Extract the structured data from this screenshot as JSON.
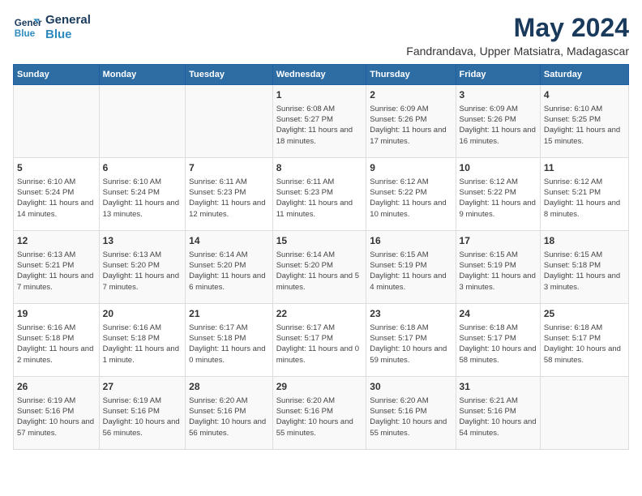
{
  "header": {
    "logo_line1": "General",
    "logo_line2": "Blue",
    "month_title": "May 2024",
    "location": "Fandrandava, Upper Matsiatra, Madagascar"
  },
  "days_of_week": [
    "Sunday",
    "Monday",
    "Tuesday",
    "Wednesday",
    "Thursday",
    "Friday",
    "Saturday"
  ],
  "weeks": [
    [
      {
        "day": "",
        "info": ""
      },
      {
        "day": "",
        "info": ""
      },
      {
        "day": "",
        "info": ""
      },
      {
        "day": "1",
        "info": "Sunrise: 6:08 AM\nSunset: 5:27 PM\nDaylight: 11 hours and 18 minutes."
      },
      {
        "day": "2",
        "info": "Sunrise: 6:09 AM\nSunset: 5:26 PM\nDaylight: 11 hours and 17 minutes."
      },
      {
        "day": "3",
        "info": "Sunrise: 6:09 AM\nSunset: 5:26 PM\nDaylight: 11 hours and 16 minutes."
      },
      {
        "day": "4",
        "info": "Sunrise: 6:10 AM\nSunset: 5:25 PM\nDaylight: 11 hours and 15 minutes."
      }
    ],
    [
      {
        "day": "5",
        "info": "Sunrise: 6:10 AM\nSunset: 5:24 PM\nDaylight: 11 hours and 14 minutes."
      },
      {
        "day": "6",
        "info": "Sunrise: 6:10 AM\nSunset: 5:24 PM\nDaylight: 11 hours and 13 minutes."
      },
      {
        "day": "7",
        "info": "Sunrise: 6:11 AM\nSunset: 5:23 PM\nDaylight: 11 hours and 12 minutes."
      },
      {
        "day": "8",
        "info": "Sunrise: 6:11 AM\nSunset: 5:23 PM\nDaylight: 11 hours and 11 minutes."
      },
      {
        "day": "9",
        "info": "Sunrise: 6:12 AM\nSunset: 5:22 PM\nDaylight: 11 hours and 10 minutes."
      },
      {
        "day": "10",
        "info": "Sunrise: 6:12 AM\nSunset: 5:22 PM\nDaylight: 11 hours and 9 minutes."
      },
      {
        "day": "11",
        "info": "Sunrise: 6:12 AM\nSunset: 5:21 PM\nDaylight: 11 hours and 8 minutes."
      }
    ],
    [
      {
        "day": "12",
        "info": "Sunrise: 6:13 AM\nSunset: 5:21 PM\nDaylight: 11 hours and 7 minutes."
      },
      {
        "day": "13",
        "info": "Sunrise: 6:13 AM\nSunset: 5:20 PM\nDaylight: 11 hours and 7 minutes."
      },
      {
        "day": "14",
        "info": "Sunrise: 6:14 AM\nSunset: 5:20 PM\nDaylight: 11 hours and 6 minutes."
      },
      {
        "day": "15",
        "info": "Sunrise: 6:14 AM\nSunset: 5:20 PM\nDaylight: 11 hours and 5 minutes."
      },
      {
        "day": "16",
        "info": "Sunrise: 6:15 AM\nSunset: 5:19 PM\nDaylight: 11 hours and 4 minutes."
      },
      {
        "day": "17",
        "info": "Sunrise: 6:15 AM\nSunset: 5:19 PM\nDaylight: 11 hours and 3 minutes."
      },
      {
        "day": "18",
        "info": "Sunrise: 6:15 AM\nSunset: 5:18 PM\nDaylight: 11 hours and 3 minutes."
      }
    ],
    [
      {
        "day": "19",
        "info": "Sunrise: 6:16 AM\nSunset: 5:18 PM\nDaylight: 11 hours and 2 minutes."
      },
      {
        "day": "20",
        "info": "Sunrise: 6:16 AM\nSunset: 5:18 PM\nDaylight: 11 hours and 1 minute."
      },
      {
        "day": "21",
        "info": "Sunrise: 6:17 AM\nSunset: 5:18 PM\nDaylight: 11 hours and 0 minutes."
      },
      {
        "day": "22",
        "info": "Sunrise: 6:17 AM\nSunset: 5:17 PM\nDaylight: 11 hours and 0 minutes."
      },
      {
        "day": "23",
        "info": "Sunrise: 6:18 AM\nSunset: 5:17 PM\nDaylight: 10 hours and 59 minutes."
      },
      {
        "day": "24",
        "info": "Sunrise: 6:18 AM\nSunset: 5:17 PM\nDaylight: 10 hours and 58 minutes."
      },
      {
        "day": "25",
        "info": "Sunrise: 6:18 AM\nSunset: 5:17 PM\nDaylight: 10 hours and 58 minutes."
      }
    ],
    [
      {
        "day": "26",
        "info": "Sunrise: 6:19 AM\nSunset: 5:16 PM\nDaylight: 10 hours and 57 minutes."
      },
      {
        "day": "27",
        "info": "Sunrise: 6:19 AM\nSunset: 5:16 PM\nDaylight: 10 hours and 56 minutes."
      },
      {
        "day": "28",
        "info": "Sunrise: 6:20 AM\nSunset: 5:16 PM\nDaylight: 10 hours and 56 minutes."
      },
      {
        "day": "29",
        "info": "Sunrise: 6:20 AM\nSunset: 5:16 PM\nDaylight: 10 hours and 55 minutes."
      },
      {
        "day": "30",
        "info": "Sunrise: 6:20 AM\nSunset: 5:16 PM\nDaylight: 10 hours and 55 minutes."
      },
      {
        "day": "31",
        "info": "Sunrise: 6:21 AM\nSunset: 5:16 PM\nDaylight: 10 hours and 54 minutes."
      },
      {
        "day": "",
        "info": ""
      }
    ]
  ]
}
